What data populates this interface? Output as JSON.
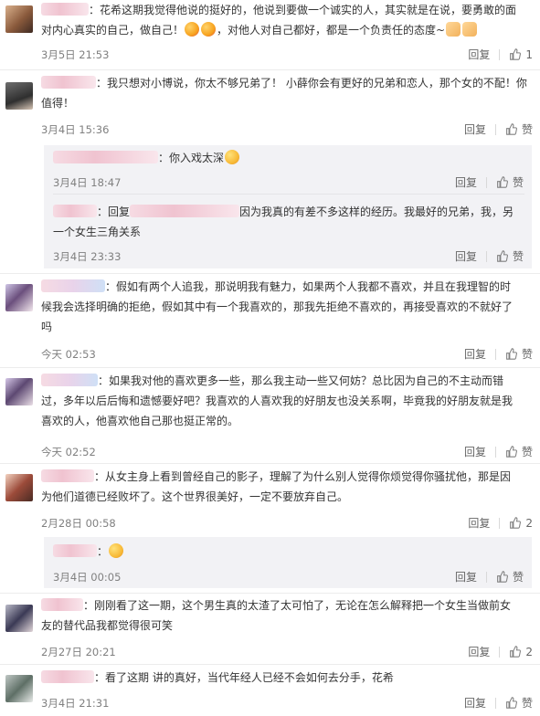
{
  "reply_label": "回复",
  "like_label": "赞",
  "comments": [
    {
      "text_line1": "：花希这期我觉得他说的挺好的，他说到要做一个诚实的人，其实就是在说，要勇敢的面",
      "text_line2a": "对内心真实的自己，做自己！",
      "text_line2b": "，对他人对自己都好，都是一个负责任的态度~",
      "time": "3月5日 21:53",
      "likes": "1"
    },
    {
      "text_line1": "：我只想对小博说，你太不够兄弟了！ 小薛你会有更好的兄弟和恋人，那个女的不配！你",
      "text_line2": "值得！",
      "time": "3月4日 15:36",
      "likes": "赞",
      "subs": [
        {
          "text": "：你入戏太深",
          "time": "3月4日 18:47",
          "likes": "赞"
        },
        {
          "text_line1a": "：回复",
          "text_line1b": "因为我真的有差不多这样的经历。我最好的兄弟，我，另",
          "text_line2": "一个女生三角关系",
          "time": "3月4日 23:33",
          "likes": "赞"
        }
      ]
    },
    {
      "text_line1": "：假如有两个人追我，那说明我有魅力，如果两个人我都不喜欢，并且在我理智的时",
      "text_line2": "候我会选择明确的拒绝，假如其中有一个我喜欢的，那我先拒绝不喜欢的，再接受喜欢的不就好了",
      "text_line3": "吗",
      "time": "今天 02:53",
      "likes": "赞"
    },
    {
      "text_line1": "：如果我对他的喜欢更多一些，那么我主动一些又何妨？总比因为自己的不主动而错",
      "text_line2": "过，多年以后后悔和遗憾要好吧？我喜欢的人喜欢我的好朋友也没关系啊，毕竟我的好朋友就是我",
      "text_line3": "喜欢的人，他喜欢他自己那也挺正常的。",
      "time": "今天 02:52",
      "likes": "赞"
    },
    {
      "text_line1": "：从女主身上看到曾经自己的影子，理解了为什么别人觉得你烦觉得你骚扰他，那是因",
      "text_line2": "为他们道德已经败坏了。这个世界很美好，一定不要放弃自己。",
      "time": "2月28日 00:58",
      "likes": "2",
      "subs": [
        {
          "text": "：",
          "time": "3月4日 00:05",
          "likes": "赞"
        }
      ]
    },
    {
      "text_line1": "：刚刚看了这一期，这个男生真的太渣了太可怕了，无论在怎么解释把一个女生当做前女",
      "text_line2": "友的替代品我都觉得很可笑",
      "time": "2月27日 20:21",
      "likes": "2"
    },
    {
      "text_line1": "：看了这期 讲的真好，当代年经人已经不会如何去分手，花希",
      "time": "3月4日 21:31",
      "likes": "赞"
    }
  ],
  "colors": {
    "name_blur": "#f0c3d0",
    "meta": "#808080",
    "sub_bg": "#f2f2f5"
  },
  "icons": [
    "thumbs-up-icon",
    "smile-emoji-icon",
    "clap-emoji-icon"
  ]
}
